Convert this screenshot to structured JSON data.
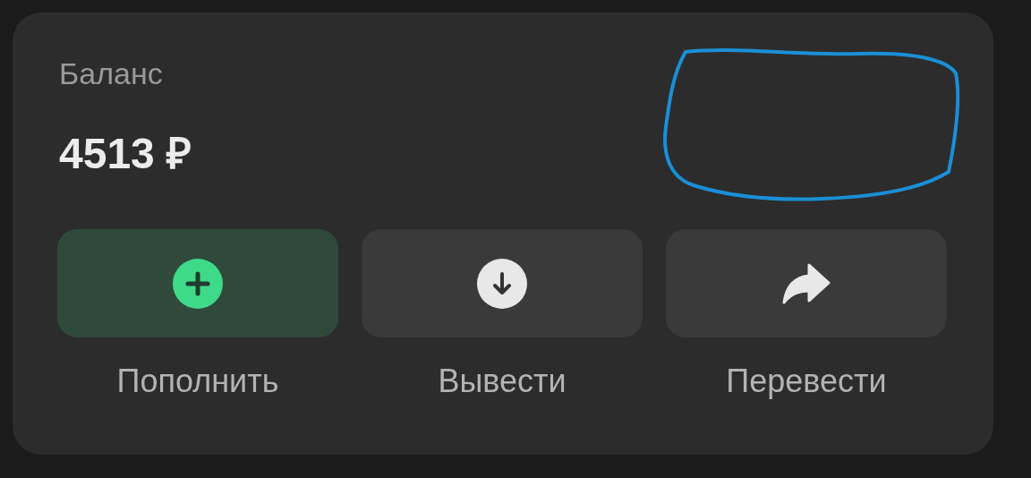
{
  "balance_card": {
    "title": "Баланс",
    "amount": "4513 ₽",
    "actions": [
      {
        "kind": "top_up",
        "label": "Пополнить"
      },
      {
        "kind": "withdraw",
        "label": "Вывести"
      },
      {
        "kind": "transfer",
        "label": "Перевести"
      }
    ]
  }
}
